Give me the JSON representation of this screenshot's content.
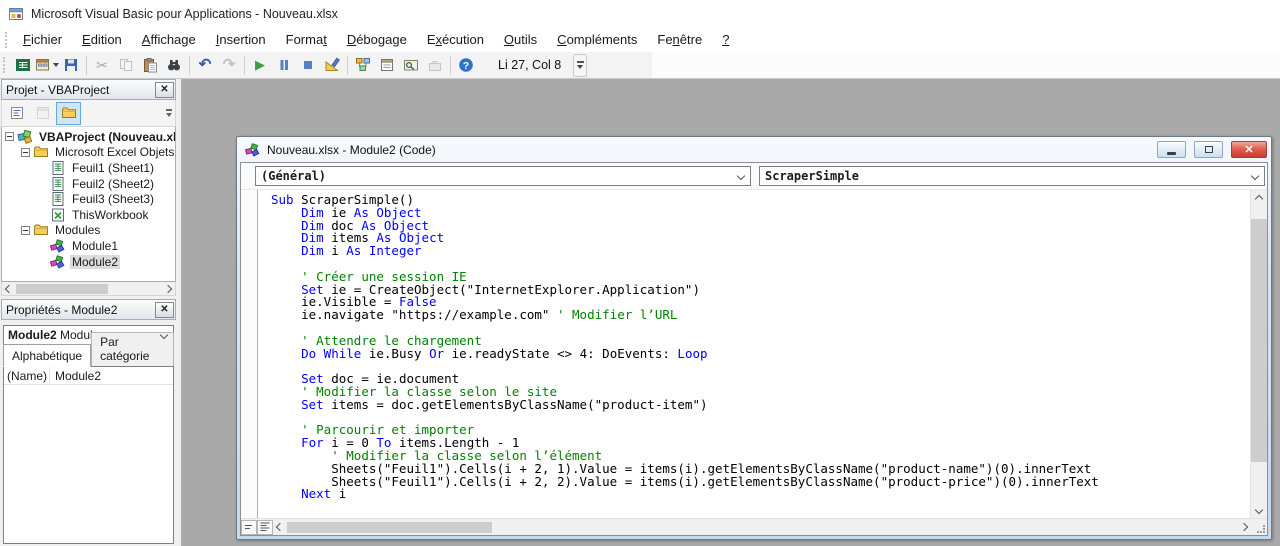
{
  "window": {
    "title": "Microsoft Visual Basic pour Applications - Nouveau.xlsx",
    "app_icon": "vba-icon"
  },
  "menu": {
    "items": [
      {
        "label": "Fichier",
        "accel": 0
      },
      {
        "label": "Edition",
        "accel": 0
      },
      {
        "label": "Affichage",
        "accel": 0
      },
      {
        "label": "Insertion",
        "accel": 0
      },
      {
        "label": "Format",
        "accel": 5
      },
      {
        "label": "Débogage",
        "accel": 0
      },
      {
        "label": "Exécution",
        "accel": 1
      },
      {
        "label": "Outils",
        "accel": 0
      },
      {
        "label": "Compléments",
        "accel": 0
      },
      {
        "label": "Fenêtre",
        "accel": 2
      },
      {
        "label": "?",
        "accel": 0
      }
    ]
  },
  "toolbar": {
    "position_indicator": "Li 27, Col 8",
    "buttons": [
      {
        "name": "view-excel-icon",
        "enabled": true
      },
      {
        "name": "insert-userform-icon",
        "enabled": true,
        "dropdown": true
      },
      {
        "name": "save-icon",
        "enabled": true
      },
      {
        "sep": true
      },
      {
        "name": "cut-icon",
        "enabled": false
      },
      {
        "name": "copy-icon",
        "enabled": false
      },
      {
        "name": "paste-icon",
        "enabled": true
      },
      {
        "name": "find-icon",
        "enabled": true
      },
      {
        "sep": true
      },
      {
        "name": "undo-icon",
        "enabled": true
      },
      {
        "name": "redo-icon",
        "enabled": false
      },
      {
        "sep": true
      },
      {
        "name": "run-icon",
        "enabled": true
      },
      {
        "name": "break-icon",
        "enabled": true
      },
      {
        "name": "reset-icon",
        "enabled": true
      },
      {
        "name": "design-mode-icon",
        "enabled": true
      },
      {
        "sep": true
      },
      {
        "name": "project-explorer-icon",
        "enabled": true
      },
      {
        "name": "properties-window-icon",
        "enabled": true
      },
      {
        "name": "object-browser-icon",
        "enabled": true
      },
      {
        "name": "toolbox-icon",
        "enabled": false
      },
      {
        "sep": true
      },
      {
        "name": "help-icon",
        "enabled": true
      }
    ]
  },
  "project_panel": {
    "title": "Projet - VBAProject",
    "toolbar": [
      {
        "name": "view-code-icon",
        "state": "normal"
      },
      {
        "name": "view-object-icon",
        "state": "disabled"
      },
      {
        "name": "toggle-folders-icon",
        "state": "selected"
      }
    ],
    "tree": [
      {
        "label": "VBAProject (Nouveau.xl",
        "depth": 0,
        "icon": "project-icon",
        "bold": true,
        "expander": "minus"
      },
      {
        "label": "Microsoft Excel Objets",
        "depth": 1,
        "icon": "folder-icon",
        "expander": "minus"
      },
      {
        "label": "Feuil1 (Sheet1)",
        "depth": 2,
        "icon": "worksheet-icon"
      },
      {
        "label": "Feuil2 (Sheet2)",
        "depth": 2,
        "icon": "worksheet-icon"
      },
      {
        "label": "Feuil3 (Sheet3)",
        "depth": 2,
        "icon": "worksheet-icon"
      },
      {
        "label": "ThisWorkbook",
        "depth": 2,
        "icon": "workbook-icon"
      },
      {
        "label": "Modules",
        "depth": 1,
        "icon": "folder-icon",
        "expander": "minus"
      },
      {
        "label": "Module1",
        "depth": 2,
        "icon": "module-icon"
      },
      {
        "label": "Module2",
        "depth": 2,
        "icon": "module-icon",
        "selected": true
      }
    ]
  },
  "properties_panel": {
    "title": "Propriétés - Module2",
    "object_selector": {
      "name": "Module2",
      "type": " Module"
    },
    "tabs": [
      {
        "label": "Alphabétique",
        "active": true
      },
      {
        "label": "Par catégorie",
        "active": false
      }
    ],
    "grid": [
      {
        "property": "(Name)",
        "value": "Module2"
      }
    ]
  },
  "code_window": {
    "title": "Nouveau.xlsx - Module2 (Code)",
    "title_icon": "module-icon",
    "left_dropdown": "(Général)",
    "right_dropdown": "ScraperSimple",
    "code_lines": [
      [
        [
          "k",
          "Sub"
        ],
        [
          "p",
          " ScraperSimple()"
        ]
      ],
      [
        [
          "p",
          "    "
        ],
        [
          "k",
          "Dim"
        ],
        [
          "p",
          " ie "
        ],
        [
          "k",
          "As"
        ],
        [
          "p",
          " "
        ],
        [
          "k",
          "Object"
        ]
      ],
      [
        [
          "p",
          "    "
        ],
        [
          "k",
          "Dim"
        ],
        [
          "p",
          " doc "
        ],
        [
          "k",
          "As"
        ],
        [
          "p",
          " "
        ],
        [
          "k",
          "Object"
        ]
      ],
      [
        [
          "p",
          "    "
        ],
        [
          "k",
          "Dim"
        ],
        [
          "p",
          " items "
        ],
        [
          "k",
          "As"
        ],
        [
          "p",
          " "
        ],
        [
          "k",
          "Object"
        ]
      ],
      [
        [
          "p",
          "    "
        ],
        [
          "k",
          "Dim"
        ],
        [
          "p",
          " i "
        ],
        [
          "k",
          "As"
        ],
        [
          "p",
          " "
        ],
        [
          "k",
          "Integer"
        ]
      ],
      [],
      [
        [
          "p",
          "    "
        ],
        [
          "c",
          "' Créer une session IE"
        ]
      ],
      [
        [
          "p",
          "    "
        ],
        [
          "k",
          "Set"
        ],
        [
          "p",
          " ie = CreateObject(\"InternetExplorer.Application\")"
        ]
      ],
      [
        [
          "p",
          "    ie.Visible = "
        ],
        [
          "k",
          "False"
        ]
      ],
      [
        [
          "p",
          "    ie.navigate \"https://example.com\" "
        ],
        [
          "c",
          "' Modifier l’URL"
        ]
      ],
      [],
      [
        [
          "p",
          "    "
        ],
        [
          "c",
          "' Attendre le chargement"
        ]
      ],
      [
        [
          "p",
          "    "
        ],
        [
          "k",
          "Do While"
        ],
        [
          "p",
          " ie.Busy "
        ],
        [
          "k",
          "Or"
        ],
        [
          "p",
          " ie.readyState <> 4: DoEvents: "
        ],
        [
          "k",
          "Loop"
        ]
      ],
      [],
      [
        [
          "p",
          "    "
        ],
        [
          "k",
          "Set"
        ],
        [
          "p",
          " doc = ie.document"
        ]
      ],
      [
        [
          "p",
          "    "
        ],
        [
          "c",
          "' Modifier la classe selon le site"
        ]
      ],
      [
        [
          "p",
          "    "
        ],
        [
          "k",
          "Set"
        ],
        [
          "p",
          " items = doc.getElementsByClassName(\"product-item\")"
        ]
      ],
      [],
      [
        [
          "p",
          "    "
        ],
        [
          "c",
          "' Parcourir et importer"
        ]
      ],
      [
        [
          "p",
          "    "
        ],
        [
          "k",
          "For"
        ],
        [
          "p",
          " i = 0 "
        ],
        [
          "k",
          "To"
        ],
        [
          "p",
          " items.Length - 1"
        ]
      ],
      [
        [
          "p",
          "        "
        ],
        [
          "c",
          "' Modifier la classe selon l’élément"
        ]
      ],
      [
        [
          "p",
          "        Sheets(\"Feuil1\").Cells(i + 2, 1).Value = items(i).getElementsByClassName(\"product-name\")(0).innerText"
        ]
      ],
      [
        [
          "p",
          "        Sheets(\"Feuil1\").Cells(i + 2, 2).Value = items(i).getElementsByClassName(\"product-price\")(0).innerText"
        ]
      ],
      [
        [
          "p",
          "    "
        ],
        [
          "k",
          "Next"
        ],
        [
          "p",
          " i"
        ]
      ]
    ]
  },
  "colors": {
    "keyword": "#0000ff",
    "comment": "#008200",
    "mdi_background": "#a9a9a9",
    "code_window_frame": "#c5d9ec",
    "close_button": "#c83d2c"
  }
}
